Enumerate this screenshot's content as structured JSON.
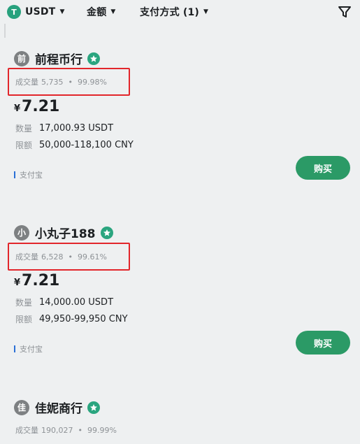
{
  "filters": {
    "coin_icon": "T",
    "coin": "USDT",
    "amount": "金额",
    "payment": "支付方式 (1)"
  },
  "ads": [
    {
      "avatar": "前",
      "merchant": "前程币行",
      "volume_label": "成交量",
      "volume": "5,735",
      "separator": "•",
      "rate": "99.98%",
      "currency": "¥",
      "price": "7.21",
      "qty_label": "数量",
      "qty": "17,000.93 USDT",
      "limit_label": "限额",
      "limit": "50,000-118,100 CNY",
      "payment_method": "支付宝",
      "buy": "购买"
    },
    {
      "avatar": "小",
      "merchant": "小丸子188",
      "volume_label": "成交量",
      "volume": "6,528",
      "separator": "•",
      "rate": "99.61%",
      "currency": "¥",
      "price": "7.21",
      "qty_label": "数量",
      "qty": "14,000.00 USDT",
      "limit_label": "限额",
      "limit": "49,950-99,950 CNY",
      "payment_method": "支付宝",
      "buy": "购买"
    },
    {
      "avatar": "佳",
      "merchant": "佳妮商行",
      "volume_label": "成交量",
      "volume": "190,027",
      "separator": "•",
      "rate": "99.99%"
    }
  ],
  "colors": {
    "accent_green": "#2b9a66",
    "verified_badge": "#2aa57f",
    "highlight_red": "#e2262b",
    "payment_bar_blue": "#2a6fd6"
  },
  "icons": {
    "filter": "funnel-icon",
    "verified": "verified-badge-icon"
  }
}
